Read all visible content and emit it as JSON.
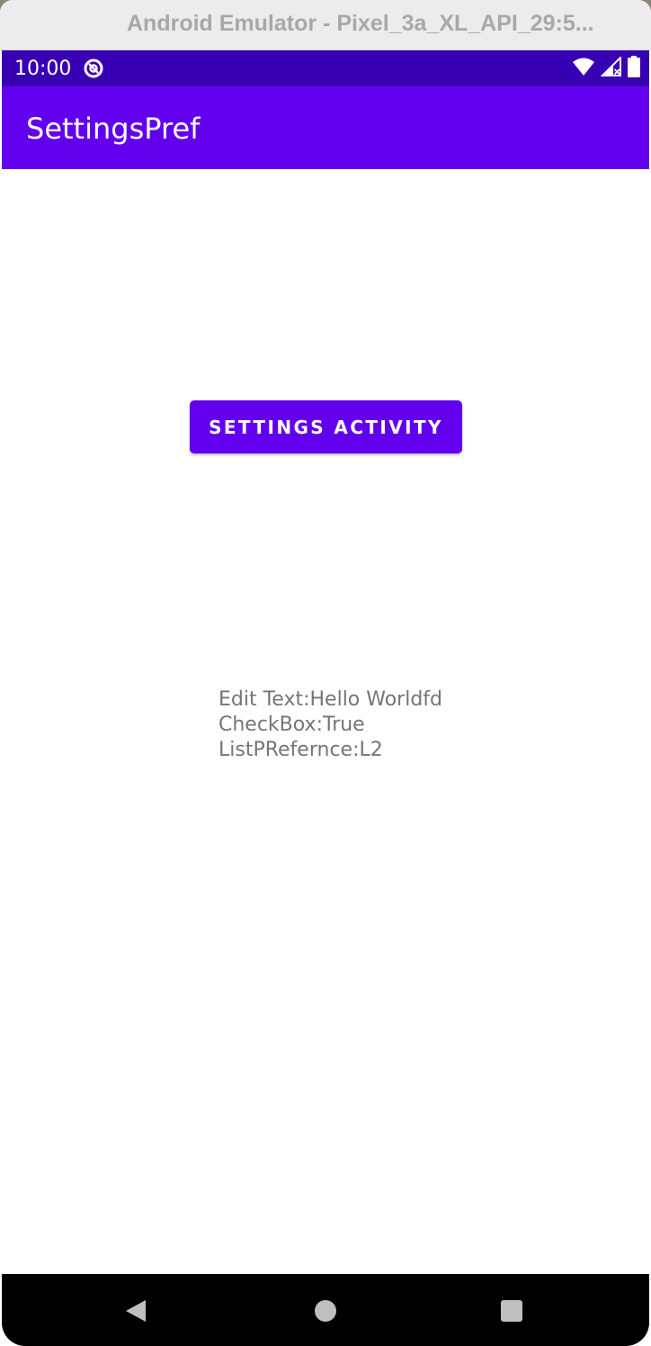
{
  "window": {
    "title": "Android Emulator - Pixel_3a_XL_API_29:5..."
  },
  "status_bar": {
    "time": "10:00",
    "icons": [
      "do-not-disturb-icon",
      "wifi-icon",
      "signal-icon",
      "battery-icon"
    ]
  },
  "app_bar": {
    "title": "SettingsPref"
  },
  "main": {
    "settings_button_label": "Settings Activity",
    "prefs": {
      "edit_text": "Edit Text:Hello Worldfd",
      "checkbox": "CheckBox:True",
      "list_preference": "ListPRefernce:L2"
    }
  },
  "nav_bar": {
    "icons": [
      "back-icon",
      "home-icon",
      "recents-icon"
    ]
  },
  "colors": {
    "status_bar": "#3700b3",
    "primary": "#6200ee",
    "text_secondary": "#757575"
  }
}
